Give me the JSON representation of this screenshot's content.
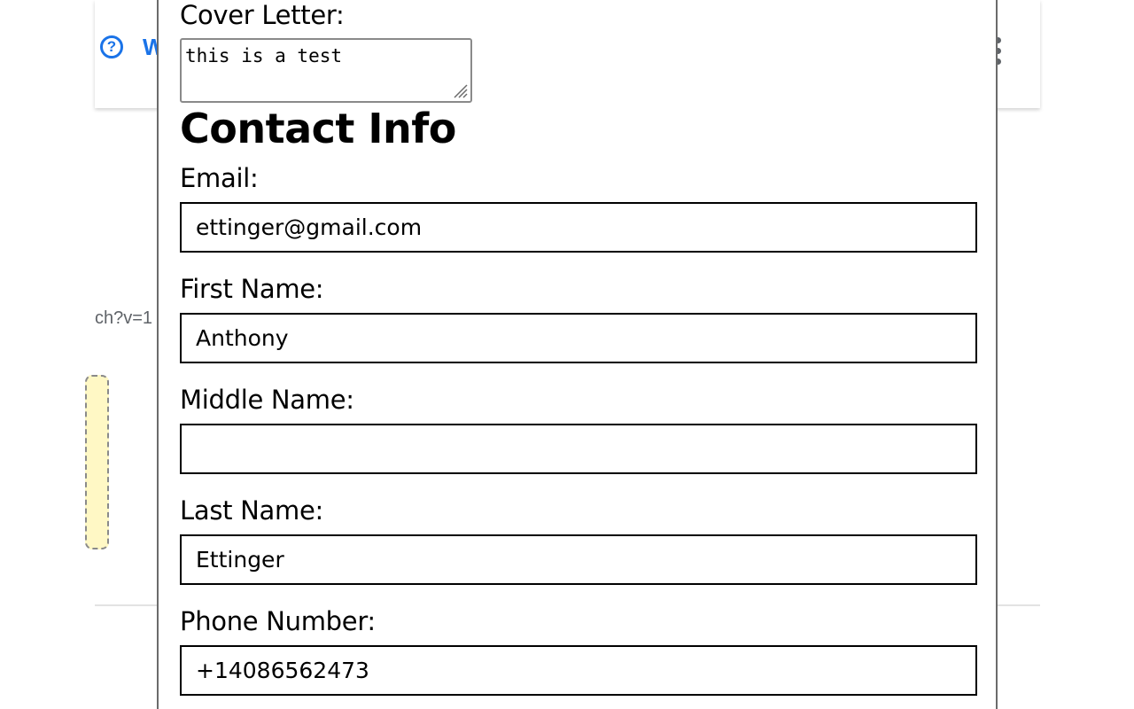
{
  "background_page": {
    "help_icon_glyph": "?",
    "help_text_partial": "W",
    "url_text_partial": "ch?v=1",
    "accent_color": "#1a73e8"
  },
  "form": {
    "cover_letter_label": "Cover Letter:",
    "cover_letter_value": "this is a test",
    "contact_heading": "Contact Info",
    "email_label": "Email:",
    "email_value": "ettinger@gmail.com",
    "first_name_label": "First Name:",
    "first_name_value": "Anthony",
    "middle_name_label": "Middle Name:",
    "middle_name_value": "",
    "last_name_label": "Last Name:",
    "last_name_value": "Ettinger",
    "phone_label": "Phone Number:",
    "phone_value": "+14086562473"
  }
}
